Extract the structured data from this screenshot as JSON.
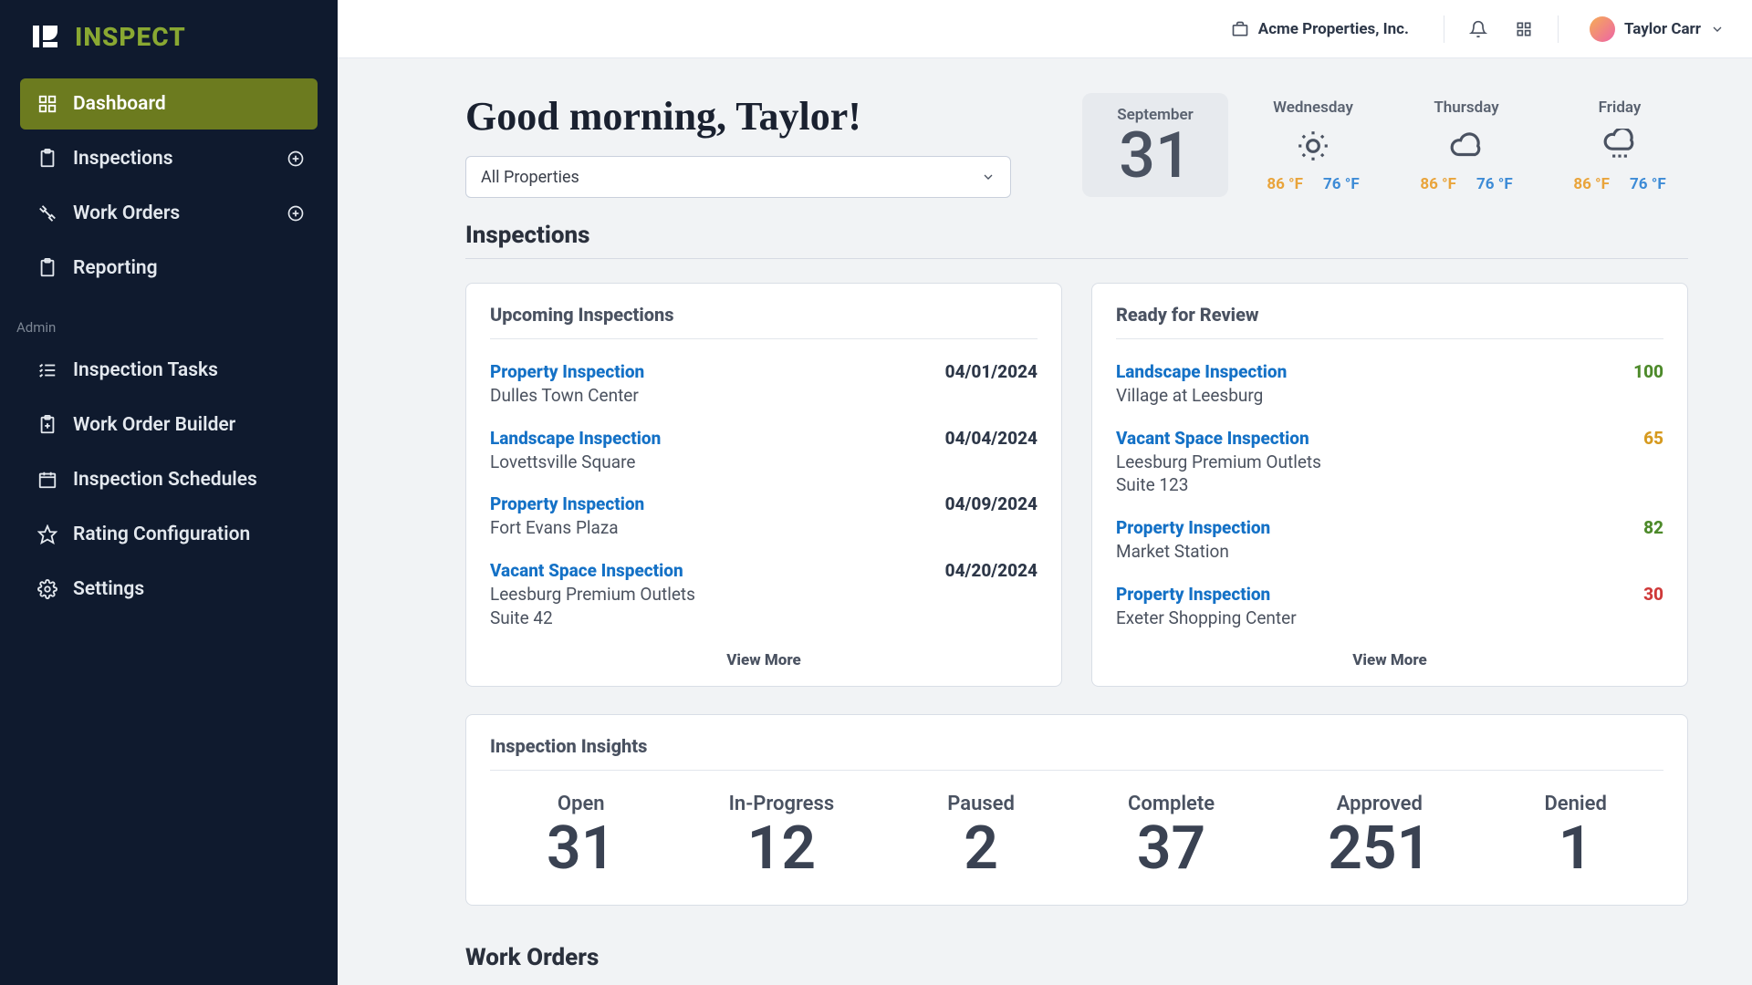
{
  "brand": {
    "name": "INSPECT"
  },
  "sidebar": {
    "main": [
      {
        "label": "Dashboard"
      },
      {
        "label": "Inspections"
      },
      {
        "label": "Work Orders"
      },
      {
        "label": "Reporting"
      }
    ],
    "admin_label": "Admin",
    "admin": [
      {
        "label": "Inspection Tasks"
      },
      {
        "label": "Work Order Builder"
      },
      {
        "label": "Inspection Schedules"
      },
      {
        "label": "Rating Configuration"
      },
      {
        "label": "Settings"
      }
    ]
  },
  "topbar": {
    "org": "Acme Properties, Inc.",
    "user": "Taylor Carr"
  },
  "greeting": "Good morning, Taylor!",
  "property_filter": "All Properties",
  "weather": {
    "today": {
      "month": "September",
      "day": "31"
    },
    "days": [
      {
        "name": "Wednesday",
        "hi": "86 °F",
        "lo": "76 °F",
        "icon": "sun"
      },
      {
        "name": "Thursday",
        "hi": "86 °F",
        "lo": "76 °F",
        "icon": "cloud"
      },
      {
        "name": "Friday",
        "hi": "86 °F",
        "lo": "76 °F",
        "icon": "rain"
      }
    ]
  },
  "sections": {
    "inspections_title": "Inspections",
    "work_orders_title": "Work Orders"
  },
  "upcoming": {
    "title": "Upcoming Inspections",
    "items": [
      {
        "type": "Property Inspection",
        "loc": "Dulles Town Center",
        "date": "04/01/2024"
      },
      {
        "type": "Landscape Inspection",
        "loc": "Lovettsville Square",
        "date": "04/04/2024"
      },
      {
        "type": "Property Inspection",
        "loc": "Fort Evans Plaza",
        "date": "04/09/2024"
      },
      {
        "type": "Vacant Space Inspection",
        "loc": "Leesburg Premium Outlets\nSuite 42",
        "date": "04/20/2024"
      }
    ],
    "view_more": "View More"
  },
  "review": {
    "title": "Ready for Review",
    "items": [
      {
        "type": "Landscape Inspection",
        "loc": "Village at Leesburg",
        "score": "100",
        "cls": "score-100"
      },
      {
        "type": "Vacant Space Inspection",
        "loc": "Leesburg Premium Outlets\nSuite 123",
        "score": "65",
        "cls": "score-65"
      },
      {
        "type": "Property Inspection",
        "loc": "Market Station",
        "score": "82",
        "cls": "score-82"
      },
      {
        "type": "Property Inspection",
        "loc": "Exeter Shopping Center",
        "score": "30",
        "cls": "score-30"
      }
    ],
    "view_more": "View More"
  },
  "insights": {
    "title": "Inspection Insights",
    "metrics": [
      {
        "label": "Open",
        "value": "31"
      },
      {
        "label": "In-Progress",
        "value": "12"
      },
      {
        "label": "Paused",
        "value": "2"
      },
      {
        "label": "Complete",
        "value": "37"
      },
      {
        "label": "Approved",
        "value": "251"
      },
      {
        "label": "Denied",
        "value": "1"
      }
    ]
  }
}
